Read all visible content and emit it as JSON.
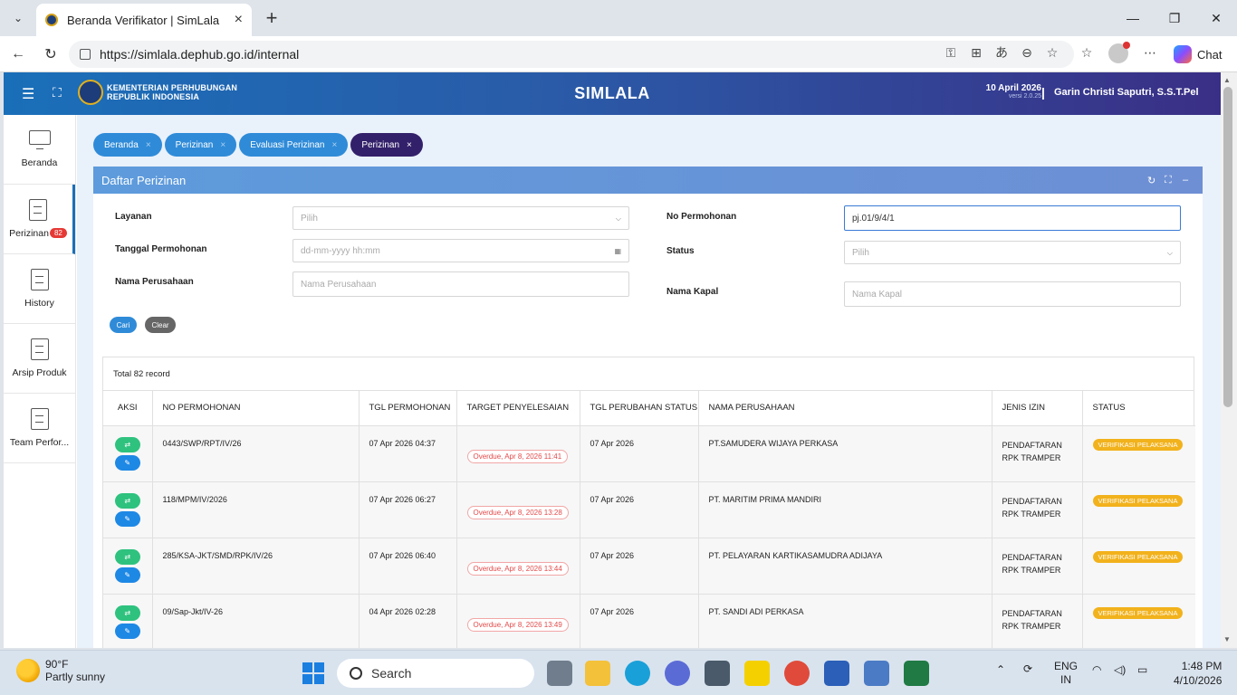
{
  "browser": {
    "tab_title": "Beranda Verifikator | SimLala",
    "url": "https://simlala.dephub.go.id/internal",
    "chat_label": "Chat"
  },
  "app": {
    "org_line1": "KEMENTERIAN PERHUBUNGAN",
    "org_line2": "REPUBLIK INDONESIA",
    "name": "SIMLALA",
    "date": "10 April 2026",
    "version": "versi 2.0.25",
    "user": "Garin Christi Saputri, S.S.T.Pel",
    "separator": "|"
  },
  "sidebar": {
    "items": [
      {
        "label": "Beranda"
      },
      {
        "label": "Perizinan",
        "badge": "82"
      },
      {
        "label": "History"
      },
      {
        "label": "Arsip Produk"
      },
      {
        "label": "Team Perfor..."
      }
    ]
  },
  "breadcrumbs": [
    "Beranda",
    "Perizinan",
    "Evaluasi Perizinan",
    "Perizinan"
  ],
  "panel": {
    "title": "Daftar Perizinan"
  },
  "form": {
    "layanan_label": "Layanan",
    "layanan_value": "Pilih",
    "tanggal_label": "Tanggal Permohonan",
    "tanggal_placeholder": "dd-mm-yyyy hh:mm",
    "perusahaan_label": "Nama Perusahaan",
    "perusahaan_placeholder": "Nama Perusahaan",
    "nopermohonan_label": "No Permohonan",
    "nopermohonan_value": "pj.01/9/4/1",
    "status_label": "Status",
    "status_value": "Pilih",
    "kapal_label": "Nama Kapal",
    "kapal_placeholder": "Nama Kapal",
    "cari_label": "Cari",
    "clear_label": "Clear"
  },
  "table": {
    "total": "Total 82 record",
    "headers": [
      "AKSI",
      "NO PERMOHONAN",
      "TGL PERMOHONAN",
      "TARGET PENYELESAIAN",
      "TGL PERUBAHAN STATUS",
      "NAMA PERUSAHAAN",
      "JENIS IZIN",
      "STATUS"
    ],
    "rows": [
      {
        "no": "0443/SWP/RPT/IV/26",
        "tgl": "07 Apr 2026 04:37",
        "target": "Overdue, Apr 8, 2026 11:41",
        "perubahan": "07 Apr 2026",
        "perusahaan": "PT.SAMUDERA WIJAYA PERKASA",
        "jenis1": "PENDAFTARAN",
        "jenis2": "RPK TRAMPER",
        "status": "VERIFIKASI PELAKSANA"
      },
      {
        "no": "118/MPM/IV/2026",
        "tgl": "07 Apr 2026 06:27",
        "target": "Overdue, Apr 8, 2026 13:28",
        "perubahan": "07 Apr 2026",
        "perusahaan": "PT. MARITIM PRIMA MANDIRI",
        "jenis1": "PENDAFTARAN",
        "jenis2": "RPK TRAMPER",
        "status": "VERIFIKASI PELAKSANA"
      },
      {
        "no": "285/KSA-JKT/SMD/RPK/IV/26",
        "tgl": "07 Apr 2026 06:40",
        "target": "Overdue, Apr 8, 2026 13:44",
        "perubahan": "07 Apr 2026",
        "perusahaan": "PT. PELAYARAN KARTIKASAMUDRA ADIJAYA",
        "jenis1": "PENDAFTARAN",
        "jenis2": "RPK TRAMPER",
        "status": "VERIFIKASI PELAKSANA"
      },
      {
        "no": "09/Sap-Jkt/IV-26",
        "tgl": "04 Apr 2026 02:28",
        "target": "Overdue, Apr 8, 2026 13:49",
        "perubahan": "07 Apr 2026",
        "perusahaan": "PT. SANDI ADI PERKASA",
        "jenis1": "PENDAFTARAN",
        "jenis2": "RPK TRAMPER",
        "status": "VERIFIKASI PELAKSANA"
      }
    ]
  },
  "taskbar": {
    "temp": "90°F",
    "weather": "Partly sunny",
    "search": "Search",
    "lang1": "ENG",
    "lang2": "IN",
    "time": "1:48 PM",
    "date": "4/10/2026"
  },
  "colors": {
    "accent": "#2f8bd8",
    "current_crumb": "#33206a",
    "status_badge": "#f2b21c",
    "overdue": "#e24a4a"
  }
}
